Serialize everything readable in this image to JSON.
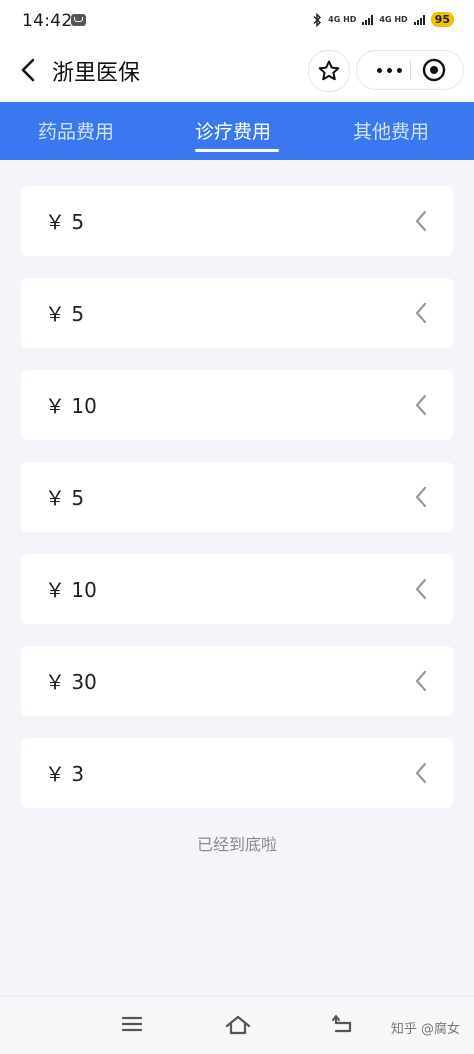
{
  "status_bar": {
    "time": "14:42",
    "net1": "4G HD",
    "net2": "4G HD",
    "battery": "95"
  },
  "header": {
    "title": "浙里医保"
  },
  "tabs": [
    {
      "label": "药品费用",
      "active": false
    },
    {
      "label": "诊疗费用",
      "active": true
    },
    {
      "label": "其他费用",
      "active": false
    }
  ],
  "items": [
    {
      "amount": "￥ 5"
    },
    {
      "amount": "￥ 5"
    },
    {
      "amount": "￥ 10"
    },
    {
      "amount": "￥ 5"
    },
    {
      "amount": "￥ 10"
    },
    {
      "amount": "￥ 30"
    },
    {
      "amount": "￥ 3"
    }
  ],
  "footer_text": "已经到底啦",
  "watermark": "知乎 @腐女",
  "colors": {
    "accent": "#3a78f0",
    "background": "#f4f5fa"
  }
}
